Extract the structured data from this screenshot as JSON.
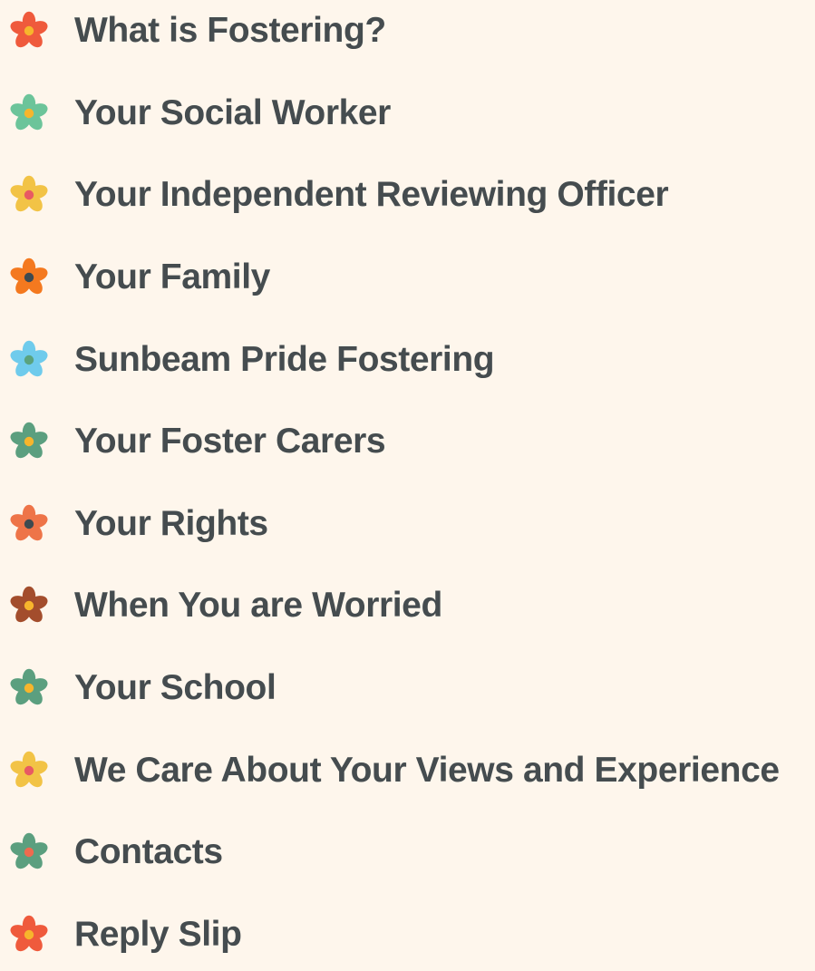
{
  "menu": {
    "items": [
      {
        "label": "What is Fostering?",
        "icon": "flower-icon",
        "petal": "#ef5a3c",
        "center": "#f7b52c"
      },
      {
        "label": "Your Social Worker",
        "icon": "flower-icon",
        "petal": "#6cc49a",
        "center": "#f7b52c"
      },
      {
        "label": "Your Independent Reviewing Officer",
        "icon": "flower-icon",
        "petal": "#f2c346",
        "center": "#e85a63"
      },
      {
        "label": "Your Family",
        "icon": "flower-icon",
        "petal": "#f4791f",
        "center": "#3d4a50"
      },
      {
        "label": "Sunbeam Pride Fostering",
        "icon": "flower-icon",
        "petal": "#6fcbec",
        "center": "#5aa37e"
      },
      {
        "label": "Your Foster Carers",
        "icon": "flower-icon",
        "petal": "#5b9f7f",
        "center": "#f7b52c"
      },
      {
        "label": "Your Rights",
        "icon": "flower-icon",
        "petal": "#ee7448",
        "center": "#3d4a50"
      },
      {
        "label": "When You are Worried",
        "icon": "flower-icon",
        "petal": "#a34d2c",
        "center": "#f7b52c"
      },
      {
        "label": "Your School",
        "icon": "flower-icon",
        "petal": "#5b9f7f",
        "center": "#f7b52c"
      },
      {
        "label": "We Care About Your Views and Experience",
        "icon": "flower-icon",
        "petal": "#f2c346",
        "center": "#e85a63"
      },
      {
        "label": "Contacts",
        "icon": "flower-icon",
        "petal": "#5b9f7f",
        "center": "#ef6a4f"
      },
      {
        "label": "Reply Slip",
        "icon": "flower-icon",
        "petal": "#ef5a3c",
        "center": "#f7b52c"
      }
    ]
  },
  "colors": {
    "background": "#fef6ec",
    "text": "#454c4f"
  }
}
